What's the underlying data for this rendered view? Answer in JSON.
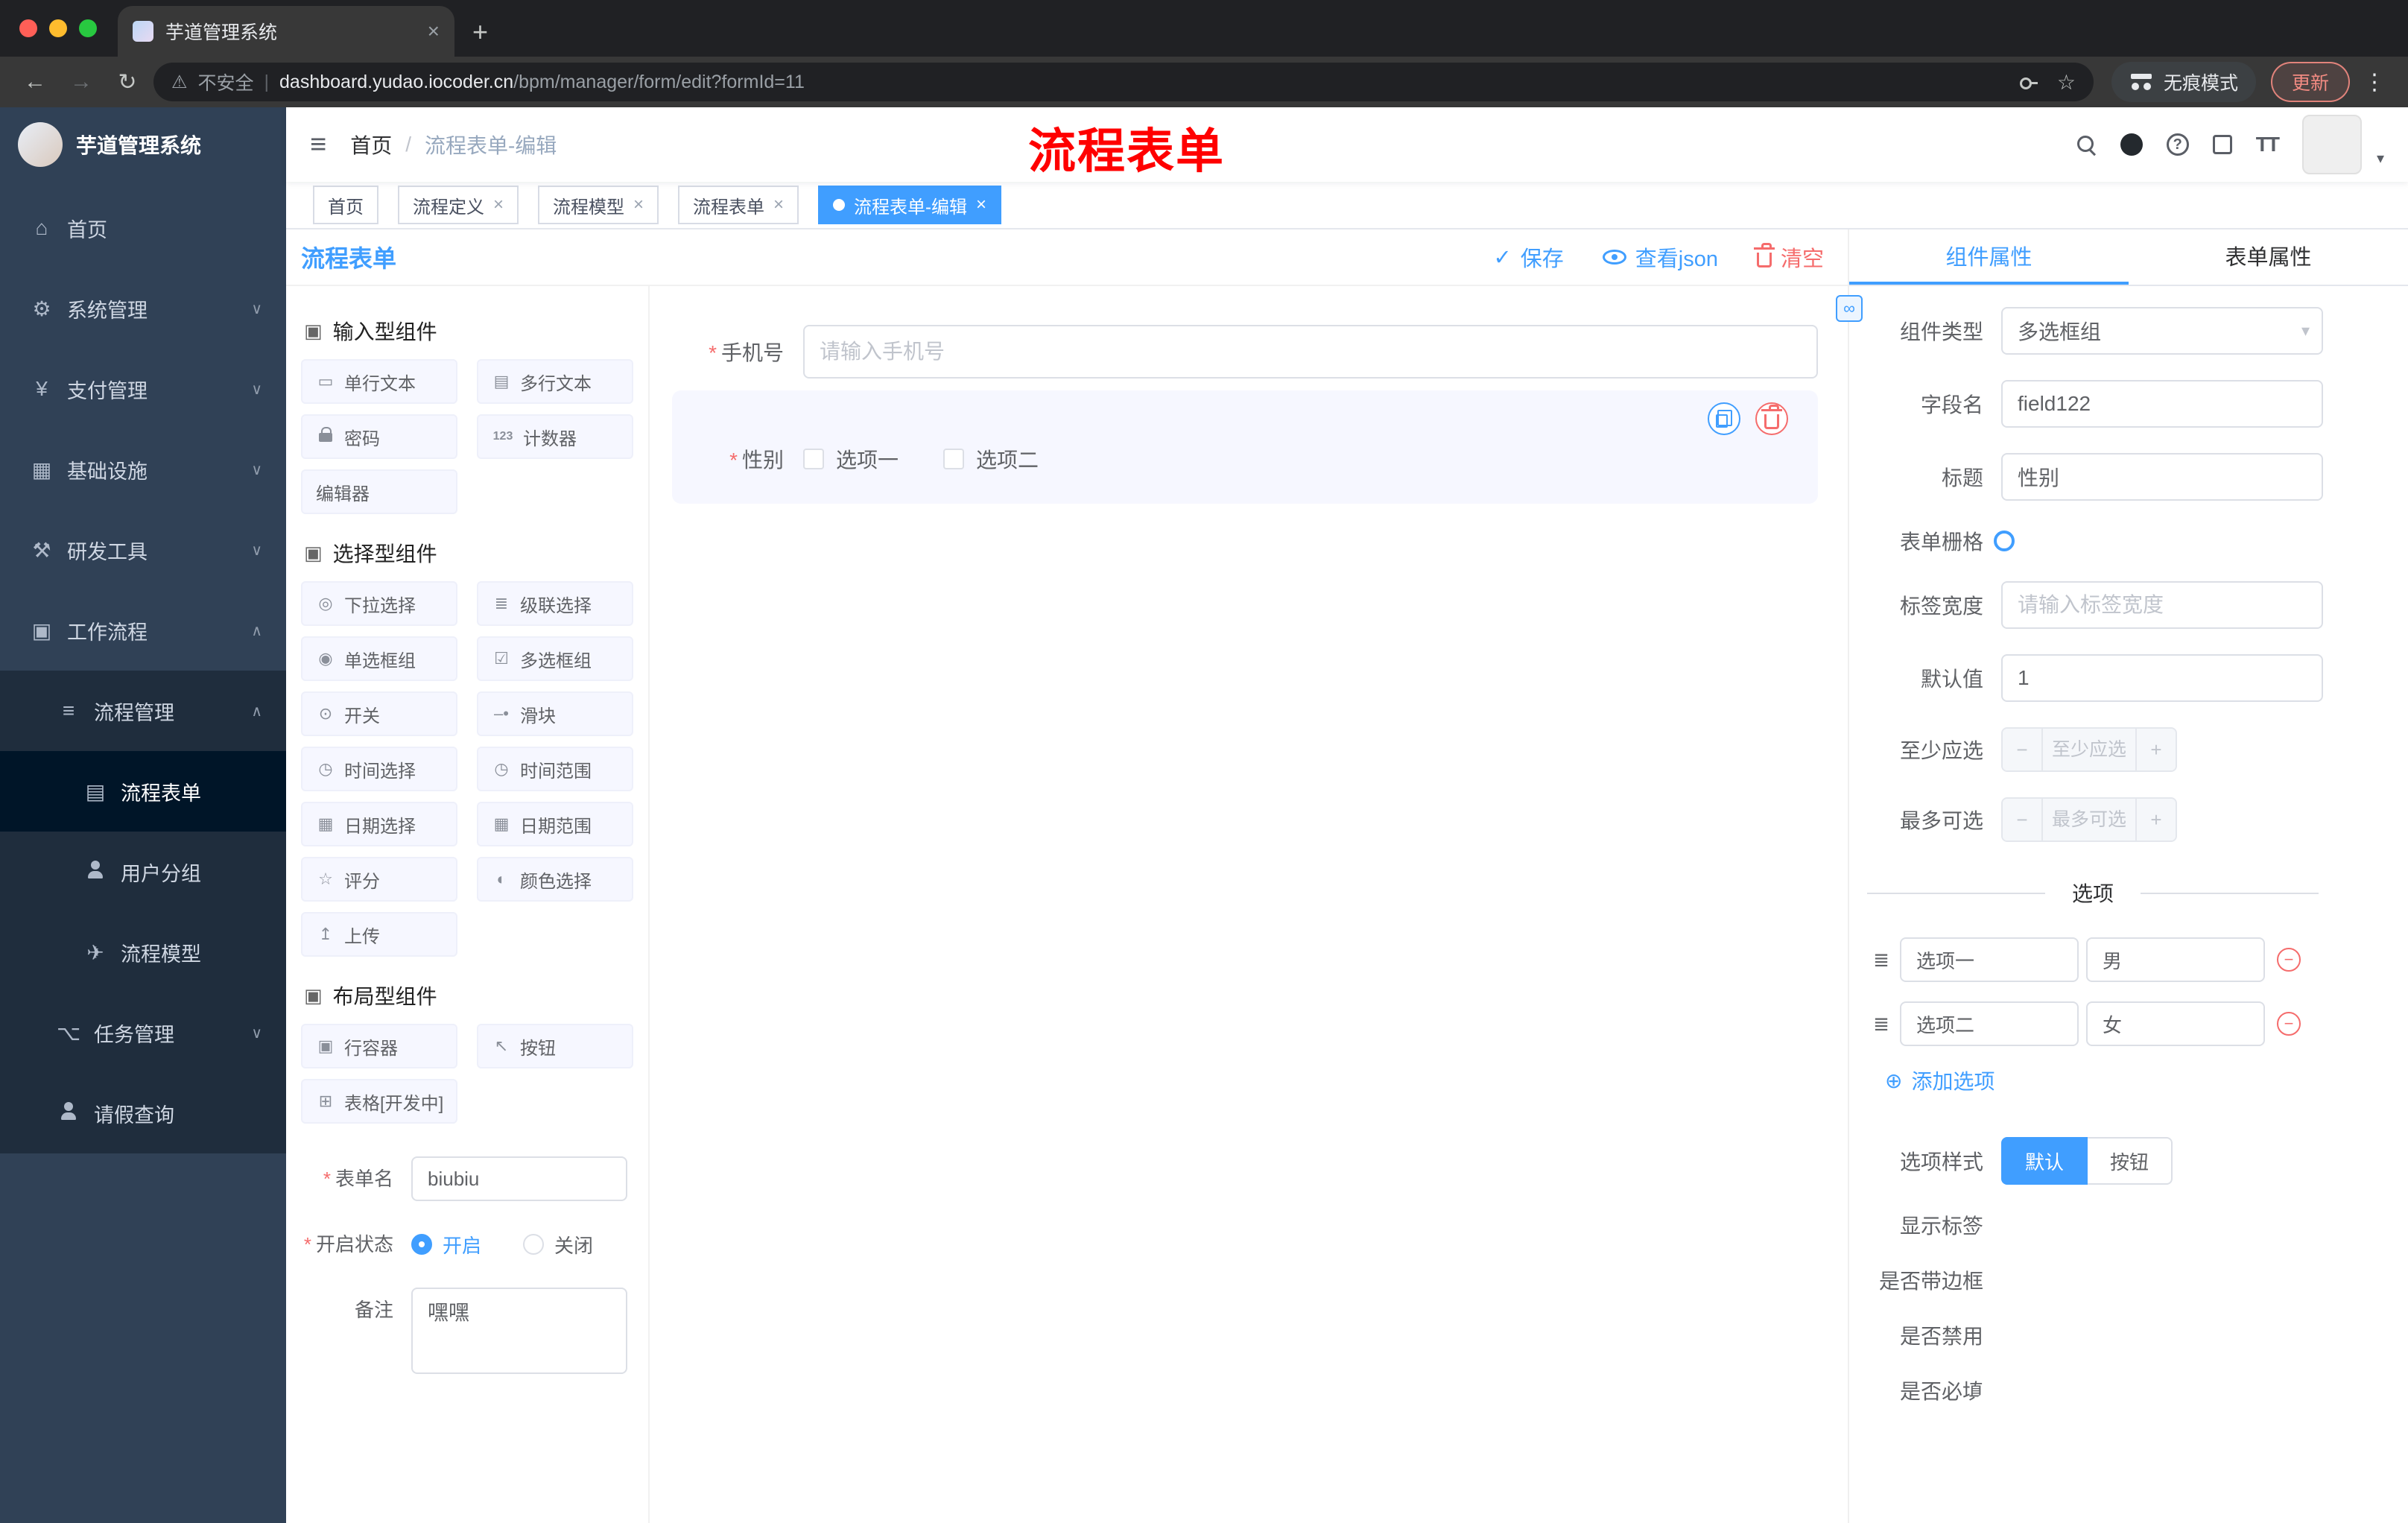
{
  "browser": {
    "tab_title": "芋道管理系统",
    "security_label": "不安全",
    "url_host": "dashboard.yudao.iocoder.cn",
    "url_path": "/bpm/manager/form/edit?formId=11",
    "incognito_label": "无痕模式",
    "update_label": "更新"
  },
  "icons": {
    "close": "×",
    "plus": "+",
    "back": "←",
    "forward": "→",
    "reload": "↻",
    "warning": "⚠",
    "pipe": "|",
    "star": "☆",
    "dots": "⋮",
    "caret": "▾",
    "chevron_down": "∨",
    "chevron_up": "∧",
    "hamburger": "≡",
    "slash": "/",
    "check": "✓",
    "question": "?",
    "textsize": "TT",
    "home": "⌂",
    "gear": "⚙",
    "yen": "¥",
    "infra": "▦",
    "tools": "⚒",
    "workflow": "▣",
    "list": "≡",
    "doc": "▤",
    "send": "✈",
    "tree": "⌥",
    "group_cube": "▣",
    "c_input": "▭",
    "c_textarea": "▤",
    "c_counter": "123",
    "c_select": "◎",
    "c_cascade": "≣",
    "c_radio": "◉",
    "c_checkbox": "☑",
    "c_switch": "⊙",
    "c_slider": "‒•",
    "c_time": "◷",
    "c_time_range": "◷",
    "c_date": "▦",
    "c_date_range": "▦",
    "c_rate": "☆",
    "c_color": "◐",
    "c_upload": "↥",
    "c_row": "▣",
    "c_button": "↖",
    "c_table": "⊞",
    "drag": "≣",
    "add_circle": "⊕",
    "minus": "−",
    "link": "∞"
  },
  "sidebar": {
    "app_title": "芋道管理系统",
    "items": [
      {
        "label": "首页"
      },
      {
        "label": "系统管理"
      },
      {
        "label": "支付管理"
      },
      {
        "label": "基础设施"
      },
      {
        "label": "研发工具"
      },
      {
        "label": "工作流程"
      },
      {
        "label": "流程管理"
      },
      {
        "label": "流程表单"
      },
      {
        "label": "用户分组"
      },
      {
        "label": "流程模型"
      },
      {
        "label": "任务管理"
      },
      {
        "label": "请假查询"
      }
    ]
  },
  "header": {
    "breadcrumb_home": "首页",
    "breadcrumb_current": "流程表单-编辑",
    "overlay_title": "流程表单"
  },
  "tags": {
    "t0": "首页",
    "t1": "流程定义",
    "t2": "流程模型",
    "t3": "流程表单",
    "t4": "流程表单-编辑"
  },
  "designer": {
    "title": "流程表单",
    "save": "保存",
    "view_json": "查看json",
    "clear": "清空",
    "groups": {
      "input_title": "输入型组件",
      "select_title": "选择型组件",
      "layout_title": "布局型组件"
    },
    "components": {
      "c0": "单行文本",
      "c1": "多行文本",
      "c2": "密码",
      "c3": "计数器",
      "c4": "编辑器",
      "s0": "下拉选择",
      "s1": "级联选择",
      "s2": "单选框组",
      "s3": "多选框组",
      "s4": "开关",
      "s5": "滑块",
      "s6": "时间选择",
      "s7": "时间范围",
      "s8": "日期选择",
      "s9": "日期范围",
      "s10": "评分",
      "s11": "颜色选择",
      "s12": "上传",
      "l0": "行容器",
      "l1": "按钮",
      "l2": "表格[开发中]"
    },
    "form": {
      "name_label": "表单名",
      "name_value": "biubiu",
      "status_label": "开启状态",
      "status_on": "开启",
      "status_off": "关闭",
      "remark_label": "备注",
      "remark_value": "嘿嘿"
    },
    "canvas": {
      "phone_label": "手机号",
      "phone_placeholder": "请输入手机号",
      "gender_label": "性别",
      "gender_opt1": "选项一",
      "gender_opt2": "选项二"
    }
  },
  "properties": {
    "tab_component": "组件属性",
    "tab_form": "表单属性",
    "component_type_label": "组件类型",
    "component_type_value": "多选框组",
    "field_name_label": "字段名",
    "field_name_value": "field122",
    "title_label": "标题",
    "title_value": "性别",
    "grid_label": "表单栅格",
    "label_width_label": "标签宽度",
    "label_width_placeholder": "请输入标签宽度",
    "default_label": "默认值",
    "default_value": "1",
    "min_label": "至少应选",
    "min_placeholder": "至少应选",
    "max_label": "最多可选",
    "max_placeholder": "最多可选",
    "options_title": "选项",
    "opt1_label": "选项一",
    "opt1_value": "男",
    "opt2_label": "选项二",
    "opt2_value": "女",
    "add_option": "添加选项",
    "style_label": "选项样式",
    "style_default": "默认",
    "style_button": "按钮",
    "toggle_show_label": "显示标签",
    "toggle_border": "是否带边框",
    "toggle_disabled": "是否禁用",
    "toggle_required": "是否必填"
  }
}
